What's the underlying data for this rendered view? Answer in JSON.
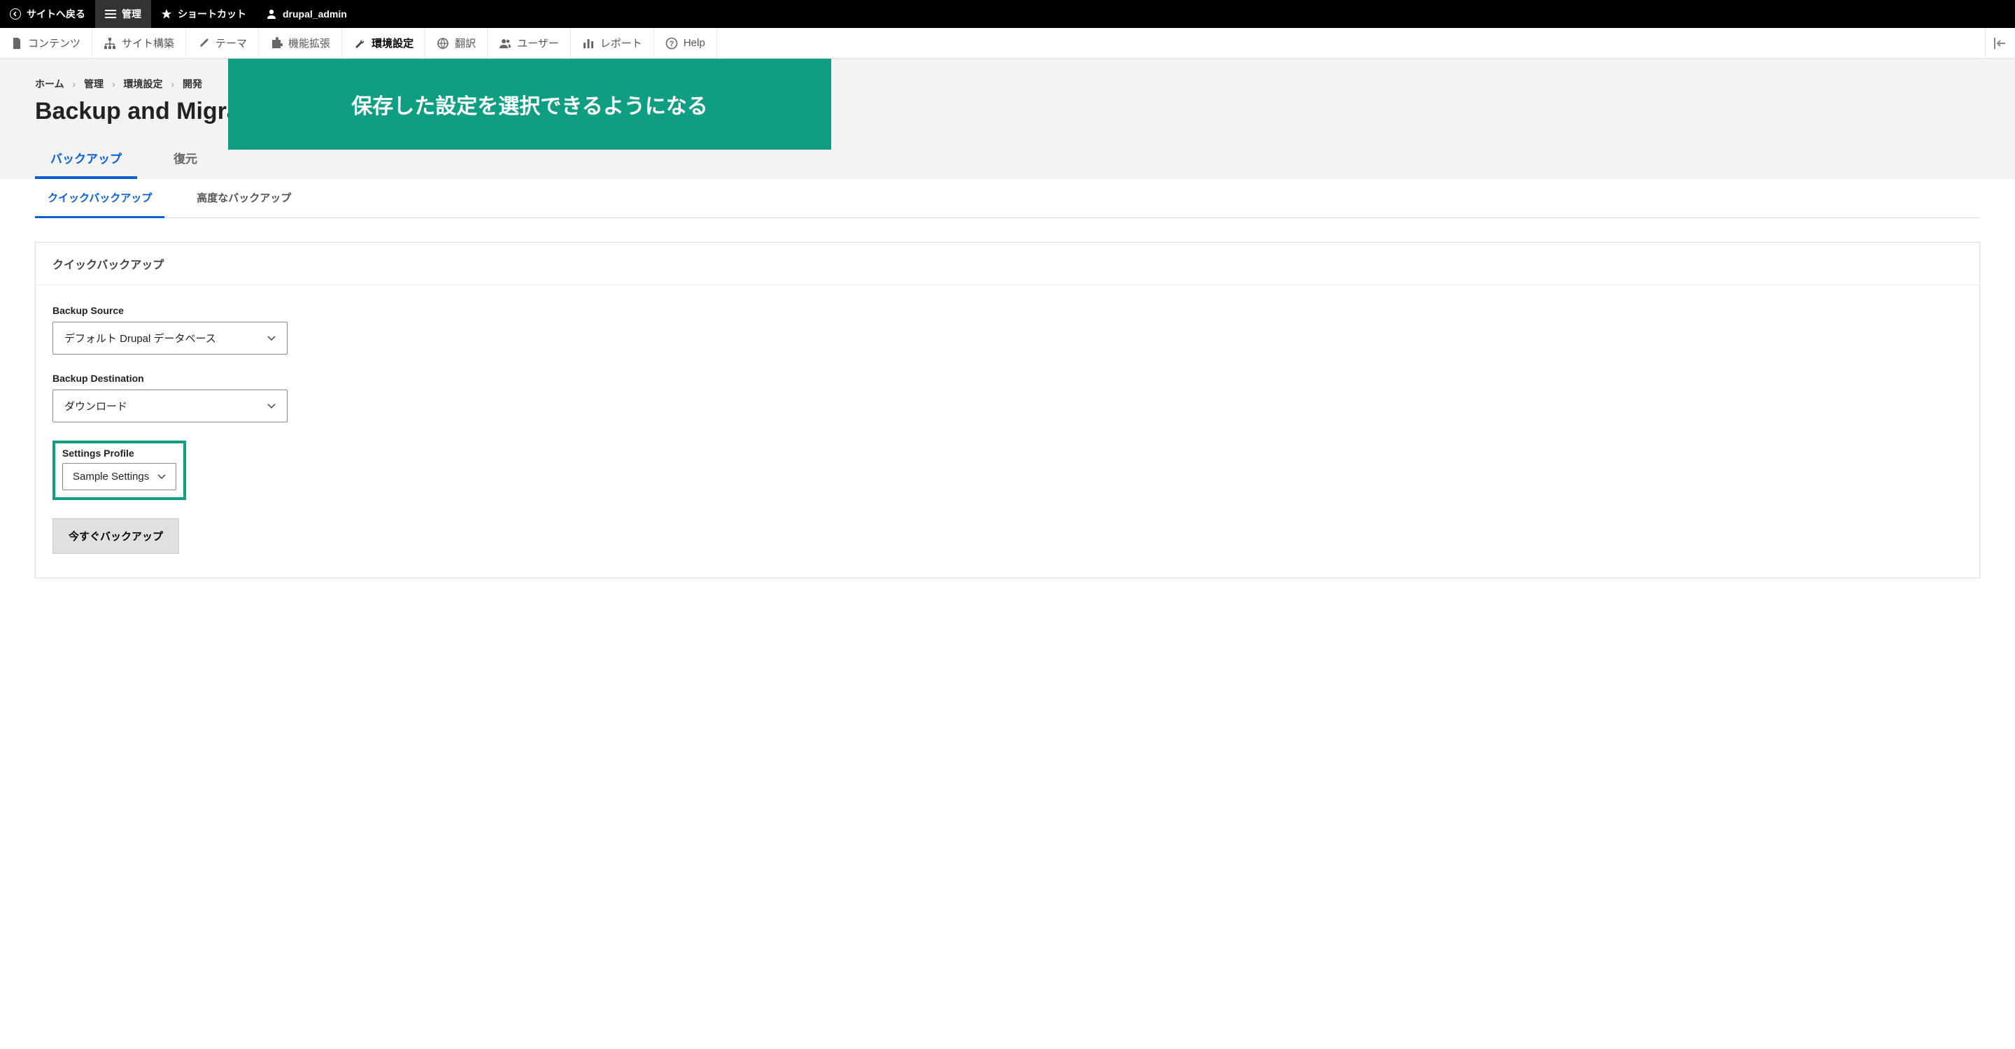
{
  "topbar": {
    "back": "サイトへ戻る",
    "manage": "管理",
    "shortcuts": "ショートカット",
    "user": "drupal_admin"
  },
  "toolbar": {
    "content": "コンテンツ",
    "structure": "サイト構築",
    "appearance": "テーマ",
    "extend": "機能拡張",
    "configuration": "環境設定",
    "translate": "翻訳",
    "people": "ユーザー",
    "reports": "レポート",
    "help": "Help"
  },
  "breadcrumb": {
    "home": "ホーム",
    "manage": "管理",
    "configuration": "環境設定",
    "development": "開発"
  },
  "page_title": "Backup and Migra",
  "overlay_text": "保存した設定を選択できるようになる",
  "primary_tabs": {
    "backup": "バックアップ",
    "restore": "復元"
  },
  "secondary_tabs": {
    "quick": "クイックバックアップ",
    "advanced": "高度なバックアップ"
  },
  "panel": {
    "title": "クイックバックアップ",
    "source_label": "Backup Source",
    "source_value": "デフォルト Drupal データベース",
    "destination_label": "Backup Destination",
    "destination_value": "ダウンロード",
    "profile_label": "Settings Profile",
    "profile_value": "Sample Settings",
    "button": "今すぐバックアップ"
  }
}
